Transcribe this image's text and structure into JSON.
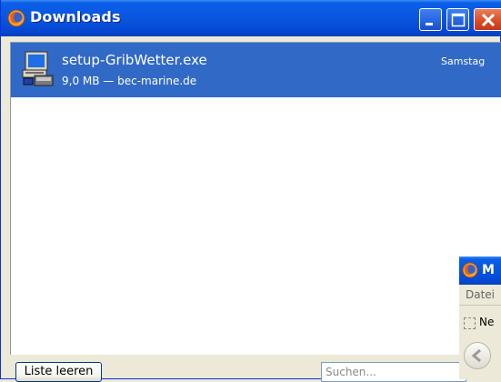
{
  "window": {
    "title": "Downloads",
    "minimize_label": "Minimize",
    "maximize_label": "Maximize",
    "close_label": "Close"
  },
  "downloads": [
    {
      "filename": "setup-GribWetter.exe",
      "date": "Samstag",
      "meta": "9,0 MB — bec-marine.de",
      "icon": "installer-icon"
    }
  ],
  "footer": {
    "clear_button_label": "Liste leeren",
    "search_placeholder": "Suchen..."
  },
  "background_window": {
    "title": "M",
    "menu_item": "Datei",
    "toolbar_label": "Ne",
    "icon": "firefox-icon"
  },
  "colors": {
    "titlebar": "#0a55e0",
    "selection": "#3169c6",
    "close_button": "#d74c27"
  }
}
